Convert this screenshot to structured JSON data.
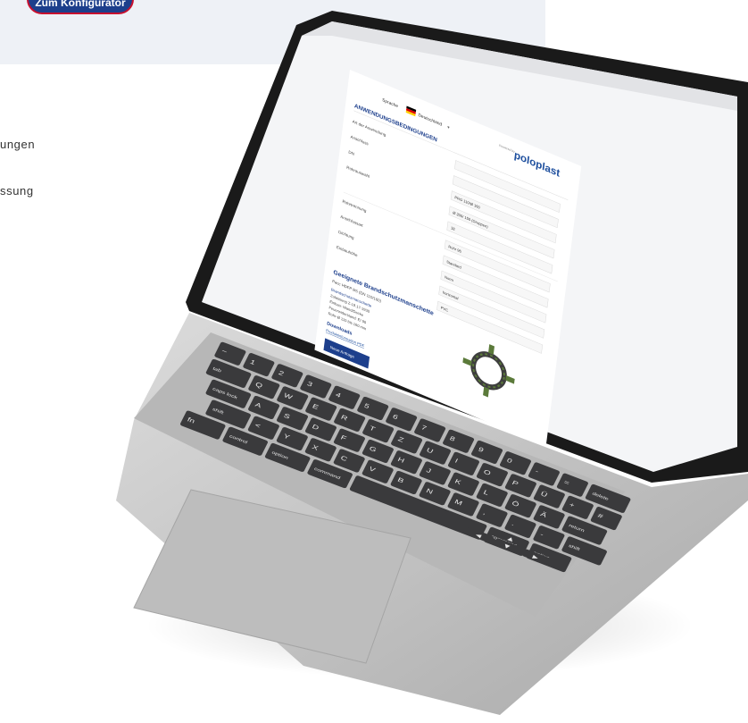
{
  "header": {
    "cta_label": "Zum Konfigurator"
  },
  "side_texts": [
    "ungen",
    "ssung"
  ],
  "screen": {
    "lang_prefix": "Sprache",
    "lang_label": "Deutschland",
    "brand_sub": "Powered by",
    "brand": "poloplast",
    "page_heading": "ANWENDUNGSBEDINGUNGEN",
    "fields": [
      {
        "label": "Art der Anwendung",
        "value": ""
      },
      {
        "label": "Anschluss",
        "value": ""
      },
      {
        "label": "DN",
        "value": "PRG 110/Ø 160"
      },
      {
        "label": "Rohrauswahl",
        "value": "Ø 200/ 150 (Gruppen)"
      },
      {
        "label": "",
        "value": "18"
      },
      {
        "label": "Rohrtrennung",
        "value": "Rohr 96"
      },
      {
        "label": "Anschlussart",
        "value": "Standard"
      },
      {
        "label": "Dichtung",
        "value": "Norm"
      },
      {
        "label": "Einbauhöhe",
        "value": "horizontal"
      },
      {
        "label": "",
        "value": "PVC"
      }
    ],
    "result_heading": "Geeignete Brandschutzmanschette",
    "result_lines": [
      "Pacc HDFP BS (DN 110/160)",
      "Brandschutzmanschette",
      "Zulassung Z-19.17-1930",
      "Einbau: Wand/Decke",
      "Feuerwiderstand: EI 90",
      "Rohr-Ø 110 bis 160 mm"
    ],
    "downloads_heading": "Downloads",
    "download_link": "Produktinformation PDF",
    "button_label": "Neue Anfrage"
  },
  "keyboard": {
    "number_row": [
      "~",
      "1",
      "2",
      "3",
      "4",
      "5",
      "6",
      "7",
      "8",
      "9",
      "0",
      "-",
      "=",
      "delete"
    ],
    "row1": [
      "tab",
      "Q",
      "W",
      "E",
      "R",
      "T",
      "Z",
      "U",
      "I",
      "O",
      "P",
      "Ü",
      "+",
      "#"
    ],
    "row2": [
      "caps lock",
      "A",
      "S",
      "D",
      "F",
      "G",
      "H",
      "J",
      "K",
      "L",
      "Ö",
      "Ä",
      "return"
    ],
    "row3": [
      "shift",
      "<",
      "Y",
      "X",
      "C",
      "V",
      "B",
      "N",
      "M",
      ",",
      ".",
      "-",
      "shift"
    ],
    "row4": [
      "fn",
      "control",
      "option",
      "command",
      "",
      "command",
      "option"
    ],
    "arrows": [
      "◀",
      "▲",
      "▼",
      "▶"
    ]
  },
  "colors": {
    "accent_blue": "#1d3f8c",
    "brand_blue": "#1e4f9e",
    "cta_border": "#c8102e",
    "key_dark": "#3a3a3c",
    "chassis": "#c9c9c9",
    "ring_green": "#5b7a3a"
  }
}
